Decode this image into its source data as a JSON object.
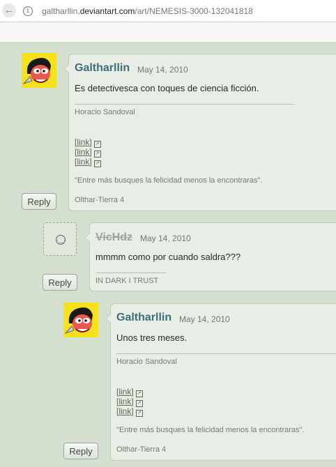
{
  "browser": {
    "back_glyph": "←",
    "info_glyph": "i",
    "url_prefix": "galtharllin",
    "url_domain": ".deviantart.com",
    "url_path": "/art/NEMESIS-3000-132041818"
  },
  "comments": [
    {
      "author": "Galtharllin",
      "date": "May 14, 2010",
      "text": "Es detectivesca con toques de ciencia ficción.",
      "sig_name": "Horacio Sandoval",
      "links": [
        "[link]",
        "[link]",
        "[link]"
      ],
      "quote": "\"Entre más busques la felicidad menos la encontraras\".",
      "location": "Olthar-Tierra 4",
      "reply": "Reply"
    },
    {
      "author": "VicHdz",
      "author_deleted": true,
      "date": "May 14, 2010",
      "text": "mmmm como por cuando saldra???",
      "signature": "IN DARK I TRUST",
      "reply": "Reply"
    },
    {
      "author": "Galtharllin",
      "date": "May 14, 2010",
      "text": "Unos tres meses.",
      "sig_name": "Horacio Sandoval",
      "links": [
        "[link]",
        "[link]",
        "[link]"
      ],
      "quote": "\"Entre más busques la felicidad menos la encontraras\".",
      "location": "Olthar-Tierra 4",
      "reply": "Reply"
    }
  ],
  "colors": {
    "page_bg": "#d4dfd0",
    "card_bg": "#e8eee6",
    "author": "#3c6d78"
  }
}
